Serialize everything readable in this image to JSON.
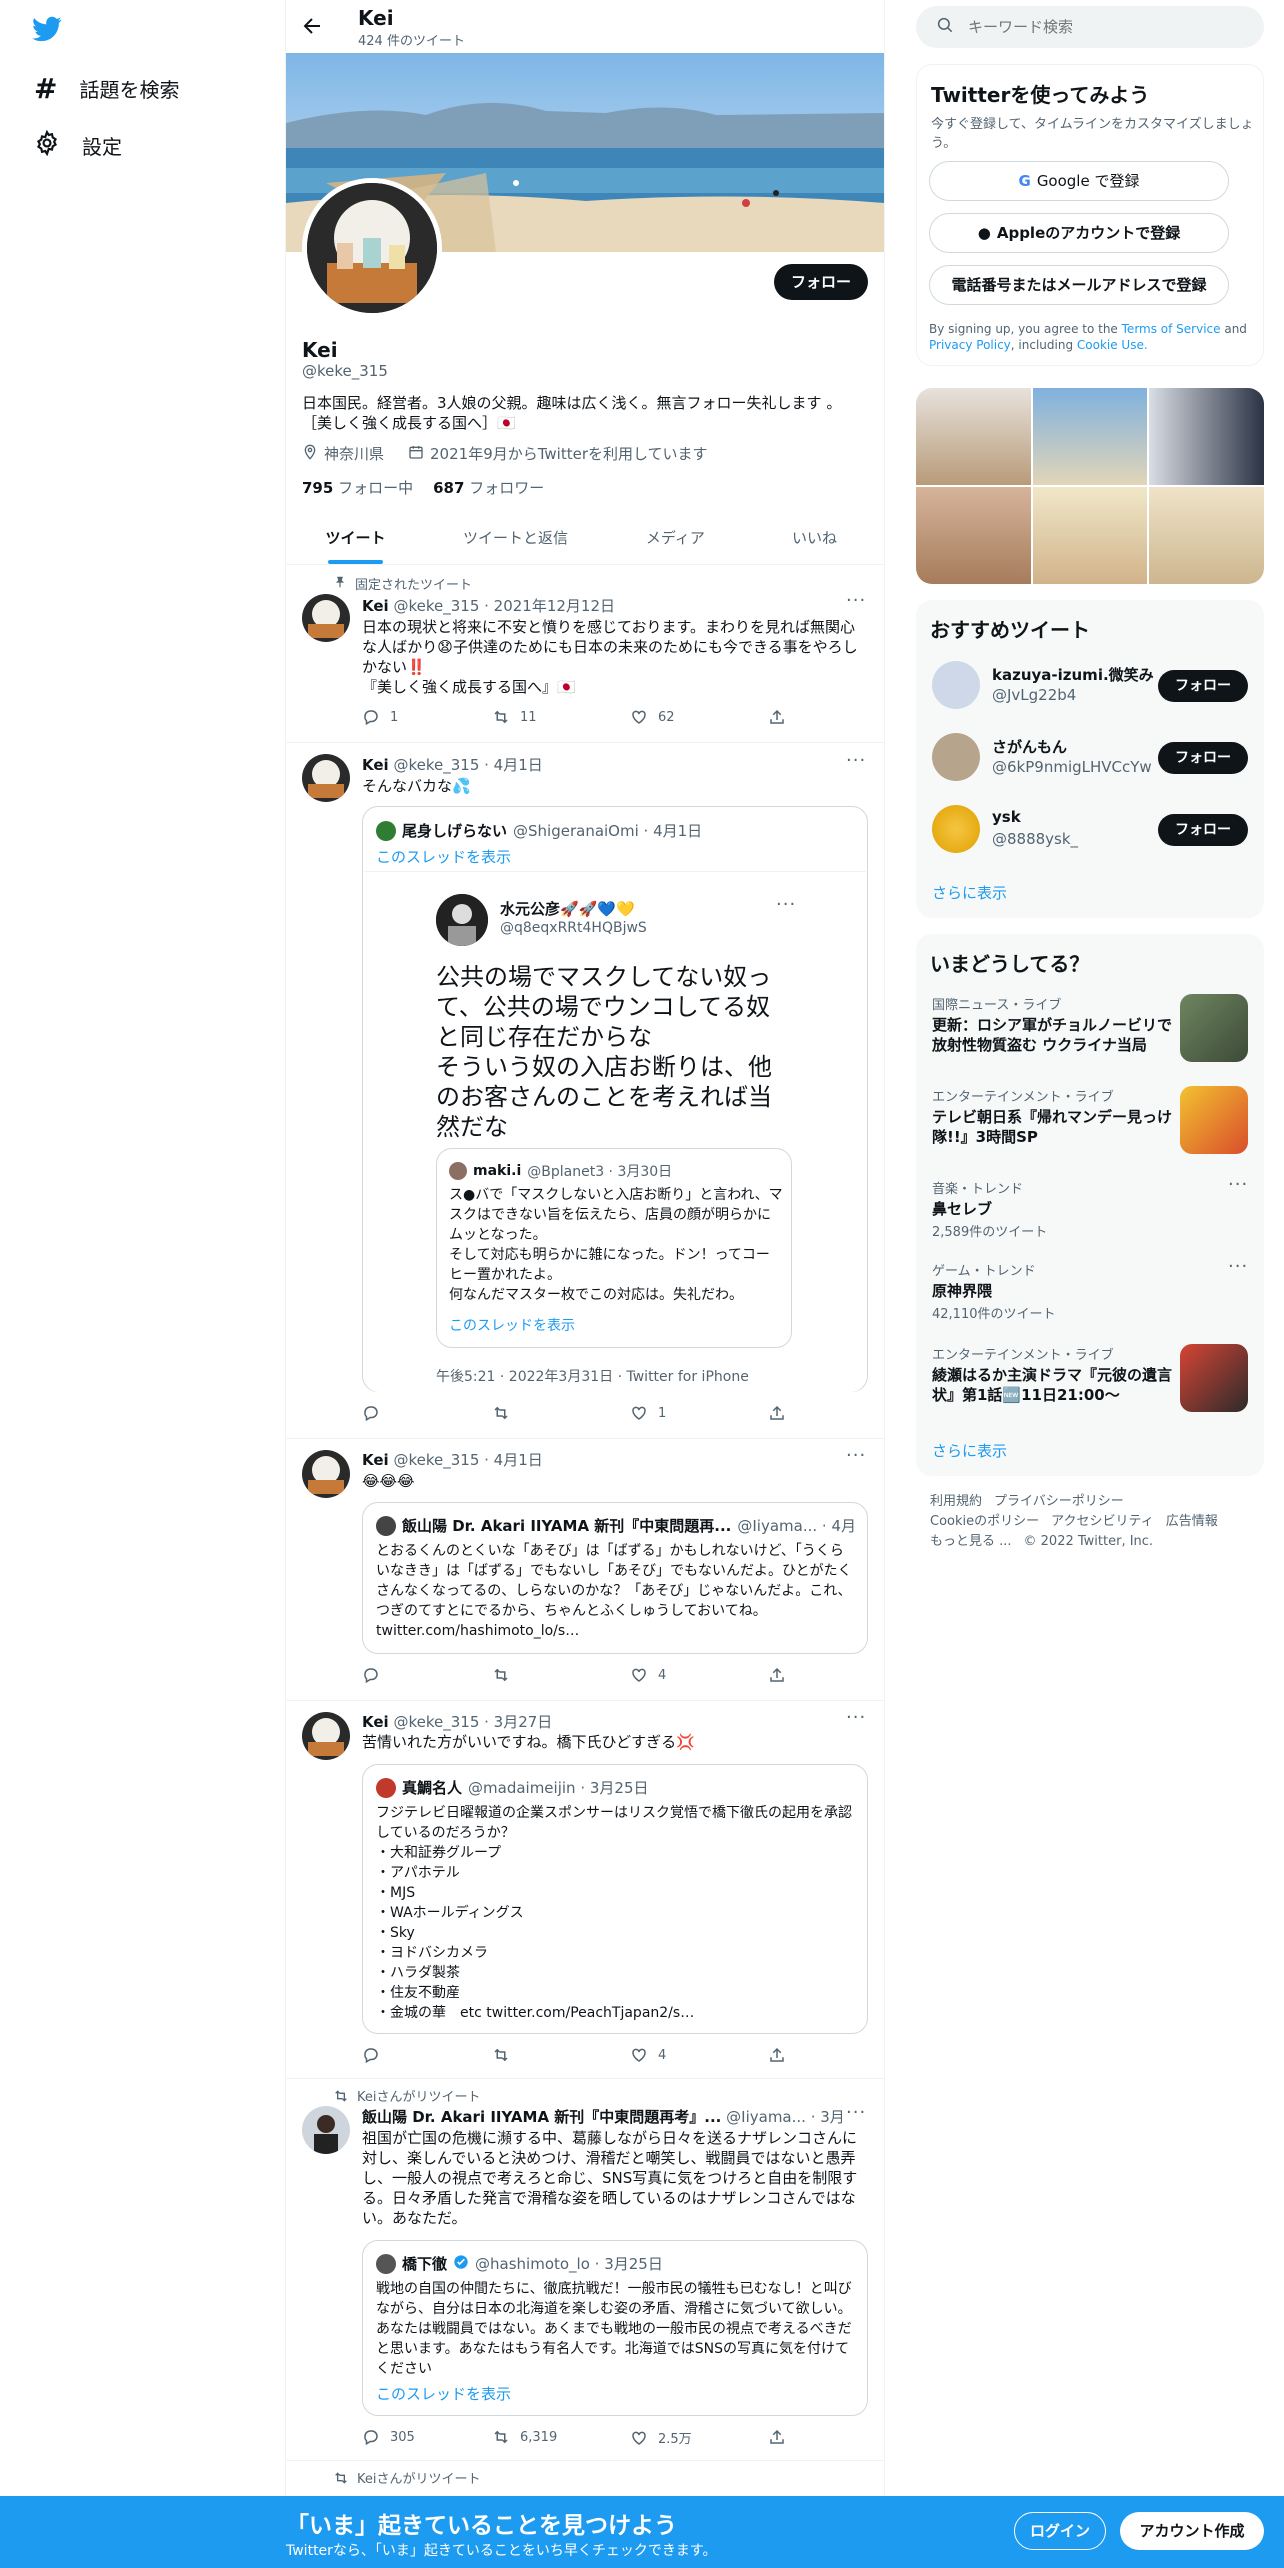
{
  "colors": {
    "accent": "#1d9bf0",
    "banner": "#1d9bf0",
    "text": "#0f1419",
    "muted": "#536471"
  },
  "nav": {
    "logo": "twitter-logo",
    "explore": "話題を検索",
    "settings": "設定"
  },
  "profile": {
    "header_name": "Kei",
    "header_count": "424 件のツイート",
    "name": "Kei",
    "handle": "@keke_315",
    "follow": "フォロー",
    "bio_line1": "日本国民。経営者。3人娘の父親。趣味は広く浅く。無言フォロー失礼します 。",
    "bio_line2": "［美しく強く成長する国へ］🇯🇵",
    "location": "神奈川県",
    "joined": "2021年9月からTwitterを利用しています",
    "following_count": "795",
    "following_label": "フォロー中",
    "followers_count": "687",
    "followers_label": "フォロワー"
  },
  "tabs": [
    "ツイート",
    "ツイートと返信",
    "メディア",
    "いいね"
  ],
  "tweets": {
    "t1": {
      "pinned": "固定されたツイート",
      "name": "Kei",
      "meta": "@keke_315 · 2021年12月12日",
      "text": "日本の現状と将来に不安と憤りを感じております。まわりを見れば無関心な人ばかり😧子供達のためにも日本の未来のためにも今できる事をやろしかない‼️\n『美しく強く成長する国へ』🇯🇵",
      "replies": "1",
      "retweets": "11",
      "likes": "62"
    },
    "t2": {
      "name": "Kei",
      "meta": "@keke_315 · 4月1日",
      "text": "そんなバカな💦",
      "q_name": "尾身しげらない",
      "q_meta": "@ShigeranaiOmi · 4月1日",
      "q_thread": "このスレッドを表示",
      "img_name": "水元公彦🚀🚀💙💛",
      "img_handle": "@q8eqxRRt4HQBjwS",
      "img_text": "公共の場でマスクしてない奴って、公共の場でウンコしてる奴と同じ存在だからな\nそういう奴の入店お断りは、他のお客さんのことを考えれば当然だな",
      "inner_name": "maki.i",
      "inner_meta": "@Bplanet3 · 3月30日",
      "inner_text": "ス●バで「マスクしないと入店お断り」と言われ、マスクはできない旨を伝えたら、店員の顔が明らかにムッとなった。\nそして対応も明らかに雑になった。ドン！ってコーヒー置かれたよ。\n何なんだマスター枚でこの対応は。失礼だわ。",
      "inner_thread": "このスレッドを表示",
      "img_footer": "午後5:21 · 2022年3月31日 · Twitter for iPhone",
      "replies": "",
      "retweets": "",
      "likes": "1"
    },
    "t3": {
      "name": "Kei",
      "meta": "@keke_315 · 4月1日",
      "text": "😂😂😂",
      "q_name": "飯山陽 Dr. Akari IIYAMA 新刊『中東問題再...",
      "q_meta": "@Iiyama... · 4月1日",
      "q_text": "とおるくんのとくいな「あそび」は「ばずる」かもしれないけど、「うくらいなきき」は「ばずる」でもないし「あそび」でもないんだよ。ひとがたくさんなくなってるの、しらないのかな？「あそび」じゃないんだよ。これ、つぎのてすとにでるから、ちゃんとふくしゅうしておいてね。 twitter.com/hashimoto_lo/s…",
      "replies": "",
      "retweets": "",
      "likes": "4"
    },
    "t4": {
      "name": "Kei",
      "meta": "@keke_315 · 3月27日",
      "text": "苦情いれた方がいいですね。橋下氏ひどすぎる💢",
      "q_name": "真鯛名人",
      "q_meta": "@madaimeijin · 3月25日",
      "q_text": "フジテレビ日曜報道の企業スポンサーはリスク覚悟で橋下徹氏の起用を承認しているのだろうか？\n・大和証券グループ\n・アパホテル\n・MJS\n・WAホールディングス\n・Sky\n・ヨドバシカメラ\n・ハラダ製茶\n・住友不動産\n・金城の華　etc twitter.com/PeachTjapan2/s…",
      "replies": "",
      "retweets": "",
      "likes": "4"
    },
    "t5": {
      "retweeted_by": "Keiさんがリツイート",
      "name": "飯山陽 Dr. Akari IIYAMA 新刊『中東問題再考』...",
      "meta": "@Iiyama... · 3月25日",
      "text": "祖国が亡国の危機に瀕する中、葛藤しながら日々を送るナザレンコさんに対し、楽しんでいると決めつけ、滑稽だと嘲笑し、戦闘員ではないと愚弄し、一般人の視点で考えろと命じ、SNS写真に気をつけろと自由を制限する。日々矛盾した発言で滑稽な姿を晒しているのはナザレンコさんではない。あなただ。",
      "q_name": "橋下徹",
      "q_meta": "@hashimoto_lo · 3月25日",
      "q_text": "戦地の自国の仲間たちに、徹底抗戦だ！一般市民の犠牲も已むなし！と叫びながら、自分は日本の北海道を楽しむ姿の矛盾、滑稽さに気づいて欲しい。あなたは戦闘員ではない。あくまでも戦地の一般市民の視点で考えるべきだと思います。あなたはもう有名人です。北海道ではSNSの写真に気を付けてください",
      "q_thread": "このスレッドを表示",
      "replies": "305",
      "retweets": "6,319",
      "likes": "2.5万"
    },
    "t6": {
      "retweeted_by": "Keiさんがリツイート"
    }
  },
  "sidebar": {
    "search_placeholder": "キーワード検索",
    "signup_title": "Twitterを使ってみよう",
    "signup_sub": "今すぐ登録して、タイムラインをカスタマイズしましょう。",
    "google_btn": "Google で登録",
    "apple_btn": "Appleのアカウントで登録",
    "phone_btn": "電話番号またはメールアドレスで登録",
    "terms_prefix": "By signing up, you agree to the ",
    "terms_link": "Terms of Service",
    "terms_and": " and ",
    "privacy_link": "Privacy Policy",
    "terms_including": ", including ",
    "cookie_link": "Cookie Use.",
    "recommend_title": "おすすめツイート",
    "follow": "フォロー",
    "users": [
      {
        "name": "kazuya-izumi.微笑み",
        "handle": "@JvLg22b4"
      },
      {
        "name": "さがんもん",
        "handle": "@6kP9nmigLHVCcYw"
      },
      {
        "name": "ysk",
        "handle": "@8888ysk_"
      }
    ],
    "show_more": "さらに表示",
    "trends_title": "いまどうしてる？",
    "trends": [
      {
        "cat": "国際ニュース・ライブ",
        "title": "更新：ロシア軍がチョルノービリで放射性物質盗む ウクライナ当局",
        "count": ""
      },
      {
        "cat": "エンターテインメント・ライブ",
        "title": "テレビ朝日系『帰れマンデー見っけ隊!!』3時間SP",
        "count": ""
      },
      {
        "cat": "音楽・トレンド",
        "title": "鼻セレブ",
        "count": "2,589件のツイート"
      },
      {
        "cat": "ゲーム・トレンド",
        "title": "原神界隈",
        "count": "42,110件のツイート"
      },
      {
        "cat": "エンターテインメント・ライブ",
        "title": "綾瀬はるか主演ドラマ『元彼の遺言状』第1話🆕11日21:00〜",
        "count": ""
      }
    ],
    "trends_more": "さらに表示",
    "footer_line1": [
      "利用規約",
      "プライバシーポリシー"
    ],
    "footer_line2": [
      "Cookieのポリシー",
      "アクセシビリティ",
      "広告情報"
    ],
    "footer_more": "もっと見る ...",
    "copyright": "© 2022 Twitter, Inc."
  },
  "banner": {
    "title": "「いま」起きていることを見つけよう",
    "sub": "Twitterなら、「いま」起きていることをいち早くチェックできます。",
    "login": "ログイン",
    "signup": "アカウント作成"
  }
}
